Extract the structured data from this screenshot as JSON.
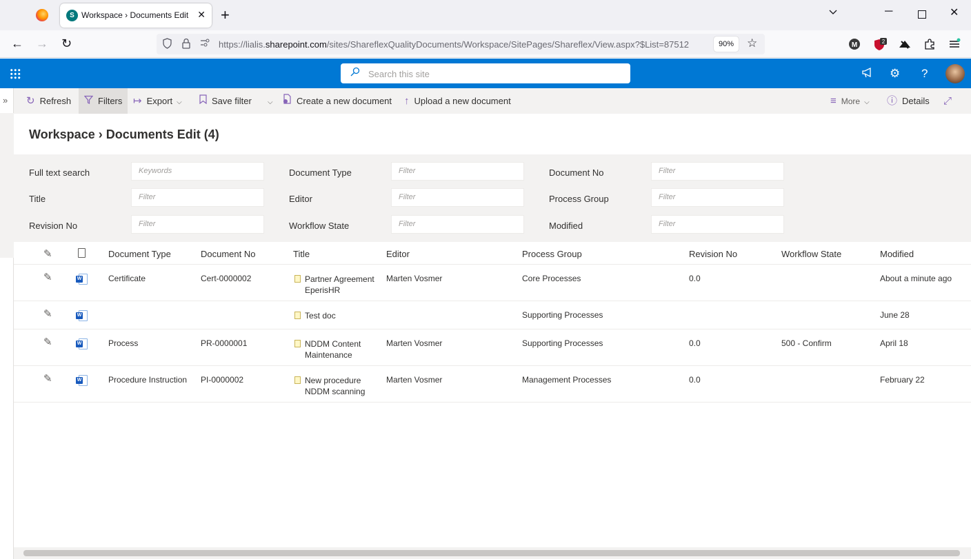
{
  "browser": {
    "tab_title": "Workspace › Documents Edit",
    "tab_favicon_letter": "S",
    "url_prefix": "https://lialis.",
    "url_domain": "sharepoint.com",
    "url_suffix": "/sites/ShareflexQualityDocuments/Workspace/SitePages/Shareflex/View.aspx?$List=87512",
    "zoom": "90%",
    "extension_badge": "2",
    "ext_m_letter": "M"
  },
  "suitebar": {
    "search_placeholder": "Search this site",
    "brand_color": "#0078d4"
  },
  "commands": {
    "refresh": "Refresh",
    "filters": "Filters",
    "export": "Export",
    "save_filter": "Save filter",
    "create_document": "Create a new document",
    "upload_document": "Upload a new document",
    "more": "More",
    "details": "Details"
  },
  "page": {
    "title": "Workspace › Documents Edit (4)"
  },
  "filters": {
    "full_text_search": {
      "label": "Full text search",
      "placeholder": "Keywords"
    },
    "document_type": {
      "label": "Document Type",
      "placeholder": "Filter"
    },
    "document_no": {
      "label": "Document No",
      "placeholder": "Filter"
    },
    "title": {
      "label": "Title",
      "placeholder": "Filter"
    },
    "editor": {
      "label": "Editor",
      "placeholder": "Filter"
    },
    "process_group": {
      "label": "Process Group",
      "placeholder": "Filter"
    },
    "revision_no": {
      "label": "Revision No",
      "placeholder": "Filter"
    },
    "workflow_state": {
      "label": "Workflow State",
      "placeholder": "Filter"
    },
    "modified": {
      "label": "Modified",
      "placeholder": "Filter"
    }
  },
  "grid": {
    "columns": {
      "document_type": "Document Type",
      "document_no": "Document No",
      "title": "Title",
      "editor": "Editor",
      "process_group": "Process Group",
      "revision_no": "Revision No",
      "workflow_state": "Workflow State",
      "modified": "Modified"
    },
    "rows": [
      {
        "document_type": "Certificate",
        "document_no": "Cert-0000002",
        "title": "Partner Agreement EperisHR",
        "editor": "Marten Vosmer",
        "process_group": "Core Processes",
        "revision_no": "0.0",
        "workflow_state": "",
        "modified": "About a minute ago"
      },
      {
        "document_type": "",
        "document_no": "",
        "title": "Test doc",
        "editor": "",
        "process_group": "Supporting Processes",
        "revision_no": "",
        "workflow_state": "",
        "modified": "June 28"
      },
      {
        "document_type": "Process",
        "document_no": "PR-0000001",
        "title": "NDDM Content Maintenance",
        "editor": "Marten Vosmer",
        "process_group": "Supporting Processes",
        "revision_no": "0.0",
        "workflow_state": "500 - Confirm",
        "modified": "April 18"
      },
      {
        "document_type": "Procedure Instruction",
        "document_no": "PI-0000002",
        "title": "New procedure NDDM scanning",
        "editor": "Marten Vosmer",
        "process_group": "Management Processes",
        "revision_no": "0.0",
        "workflow_state": "",
        "modified": "February 22"
      }
    ]
  }
}
